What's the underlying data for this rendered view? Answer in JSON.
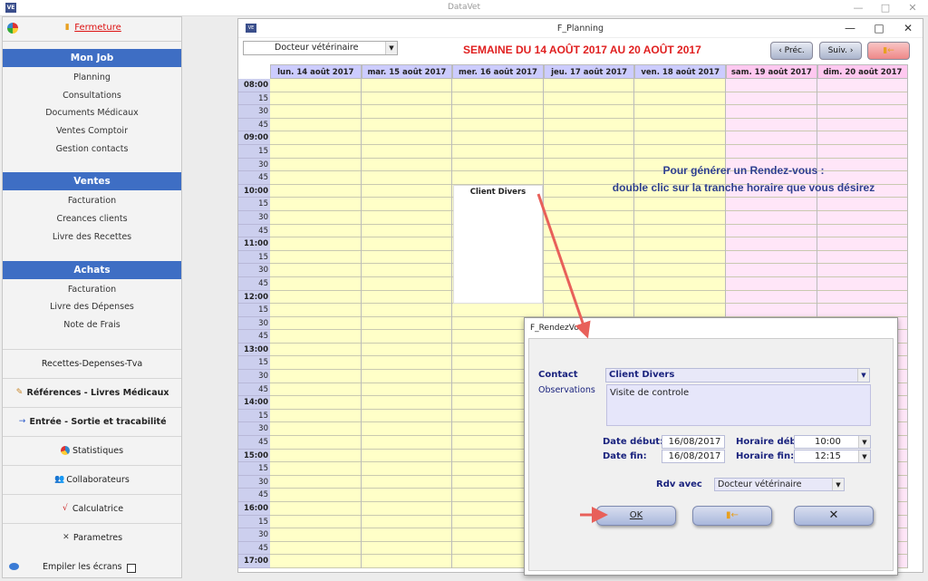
{
  "app": {
    "title": "DataVet",
    "min_glyph": "—",
    "max_glyph": "□",
    "close_glyph": "✕"
  },
  "sidebar": {
    "exit_label": "Fermeture",
    "sections": [
      {
        "title": "Mon Job",
        "items": [
          "Planning",
          "Consultations",
          "Documents Médicaux",
          "Ventes Comptoir",
          "Gestion contacts"
        ]
      },
      {
        "title": "Ventes",
        "items": [
          "Facturation",
          "Creances clients",
          "Livre des Recettes"
        ]
      },
      {
        "title": "Achats",
        "items": [
          "Facturation",
          "Livre des Dépenses",
          "Note de Frais"
        ]
      }
    ],
    "extras": {
      "rdt": "Recettes-Depenses-Tva",
      "refs": "Références - Livres Médicaux",
      "entree": "Entrée - Sortie et tracabilité",
      "stats": "Statistiques",
      "collab": "Collaborateurs",
      "calc": "Calculatrice",
      "params": "Parametres",
      "stack": "Empiler les écrans"
    }
  },
  "planning": {
    "window_title": "F_Planning",
    "vet_select": "Docteur vétérinaire",
    "week_label": "SEMAINE DU 14 AOÛT 2017 AU 20 AOÛT 2017",
    "prev_label": "Préc.",
    "next_label": "Suiv.",
    "days": [
      "lun. 14 août 2017",
      "mar. 15 août 2017",
      "mer. 16 août 2017",
      "jeu. 17 août 2017",
      "ven. 18 août 2017",
      "sam. 19 août 2017",
      "dim. 20 août 2017"
    ],
    "time_slots": [
      "08:00",
      "15",
      "30",
      "45",
      "09:00",
      "15",
      "30",
      "45",
      "10:00",
      "15",
      "30",
      "45",
      "11:00",
      "15",
      "30",
      "45",
      "12:00",
      "15",
      "30",
      "45",
      "13:00",
      "15",
      "30",
      "45",
      "14:00",
      "15",
      "30",
      "45",
      "15:00",
      "15",
      "30",
      "45",
      "16:00",
      "15",
      "30",
      "45",
      "17:00"
    ],
    "appointment": {
      "label": "Client Divers"
    },
    "hint_lines": [
      "Pour générer un Rendez-vous :",
      "double clic sur la tranche horaire que vous désirez"
    ],
    "colors": {
      "weekday": "#ffffc8",
      "weekend": "#ffe6f8",
      "time": "#cccfee",
      "hdr_weekday": "#ccccff",
      "hdr_weekend": "#ffc8f0"
    }
  },
  "dialog": {
    "title": "F_RendezVous",
    "contact_label": "Contact",
    "contact_value": "Client Divers",
    "obs_label": "Observations",
    "obs_value": "Visite de controle",
    "date_start_label": "Date début:",
    "date_start_value": "16/08/2017",
    "date_end_label": "Date fin:",
    "date_end_value": "16/08/2017",
    "hour_start_label": "Horaire déb",
    "hour_start_value": "10:00",
    "hour_end_label": "Horaire fin:",
    "hour_end_value": "12:15",
    "rdv_with_label": "Rdv avec",
    "rdv_with_value": "Docteur vétérinaire",
    "ok_label": "OK"
  }
}
